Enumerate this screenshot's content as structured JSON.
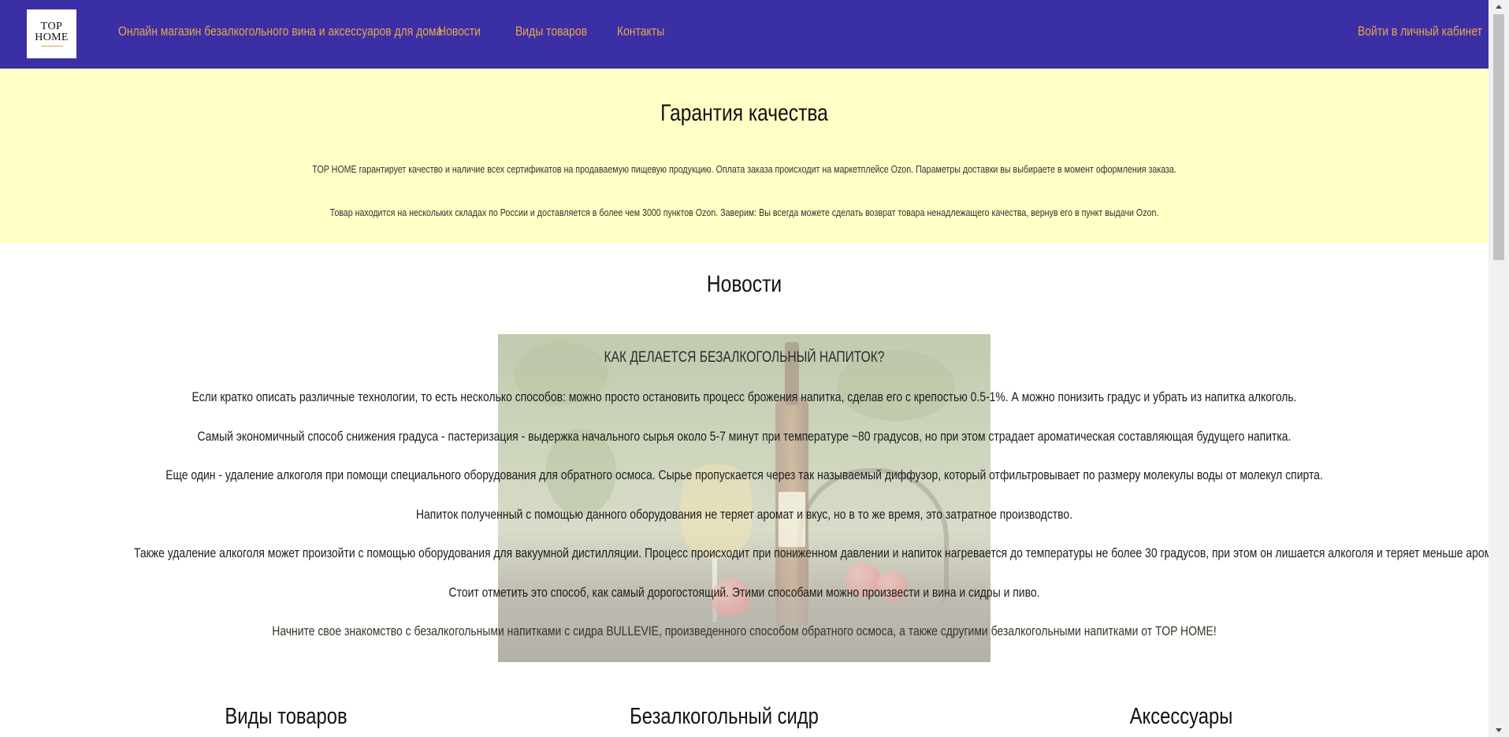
{
  "header": {
    "logo_line1": "TOP",
    "logo_line2": "HOME",
    "nav": [
      {
        "label": "Онлайн магазин безалкогольного вина и аксессуаров для дома"
      },
      {
        "label": "Новости"
      },
      {
        "label": "Виды товаров"
      },
      {
        "label": "Контакты"
      }
    ],
    "login_label": "Войти в личный кабинет"
  },
  "quality": {
    "title": "Гарантия качества",
    "paragraph1": "TOP HOME гарантирует качество и наличие всех сертификатов на продаваемую пищевую продукцию. Оплата заказа происходит на маркетплейсе Ozon. Параметры доставки вы выбираете в момент оформления заказа.",
    "paragraph2": "Товар находится на нескольких складах по России и доставляется в более чем 3000 пунктов Ozon. Заверим: Вы всегда можете сделать возврат товара ненадлежащего качества, вернув его в пункт выдачи Ozon."
  },
  "news": {
    "title": "Новости",
    "article_title": "Как делается безалкогольный напиток?",
    "paragraphs": [
      "Если кратко описать различные технологии, то есть несколько способов: можно просто остановить процесс брожения напитка, сделав его с крепостью 0.5-1%. А можно понизить градус и убрать из напитка алкоголь.",
      "Самый экономичный способ снижения градуса - пастеризация - выдержка начального сырья около 5-7 минут при температуре ~80 градусов, но при этом страдает ароматическая составляющая будущего напитка.",
      "Еще один - удаление алкоголя при помощи специального оборудования для обратного осмоса. Сырье пропускается через так называемый диффузор, который отфильтровывает по размеру молекулы воды от молекул спирта.",
      "Напиток полученный с помощью данного оборудования не теряет аромат и вкус, но в то же время, это затратное производство.",
      "Также удаление алкоголя может произойти с помощью оборудования для вакуумной дистилляции. Процесс происходит при пониженном давлении и напиток нагревается до температуры не более 30 градусов, при этом он лишается алкоголя и теряет меньше ароматики, чем при пастеризации.",
      "Стоит отметить это способ, как самый дорогостоящий. Этими способами можно произвести и вина и сидры и пиво.",
      "Начните свое знакомство с безалкогольными напитками с сидра BULLEVIE, произведенного способом обратного осмоса, а также сдругими безалкогольными напитками от TOP HOME!"
    ]
  },
  "categories": {
    "left_title": "Виды товаров",
    "middle_title": "Безалкогольный сидр",
    "right_title": "Аксессуары"
  },
  "colors": {
    "header_bg": "#3b2fa6",
    "nav_text": "#e8a54d",
    "quality_bg": "#ffffc6"
  }
}
